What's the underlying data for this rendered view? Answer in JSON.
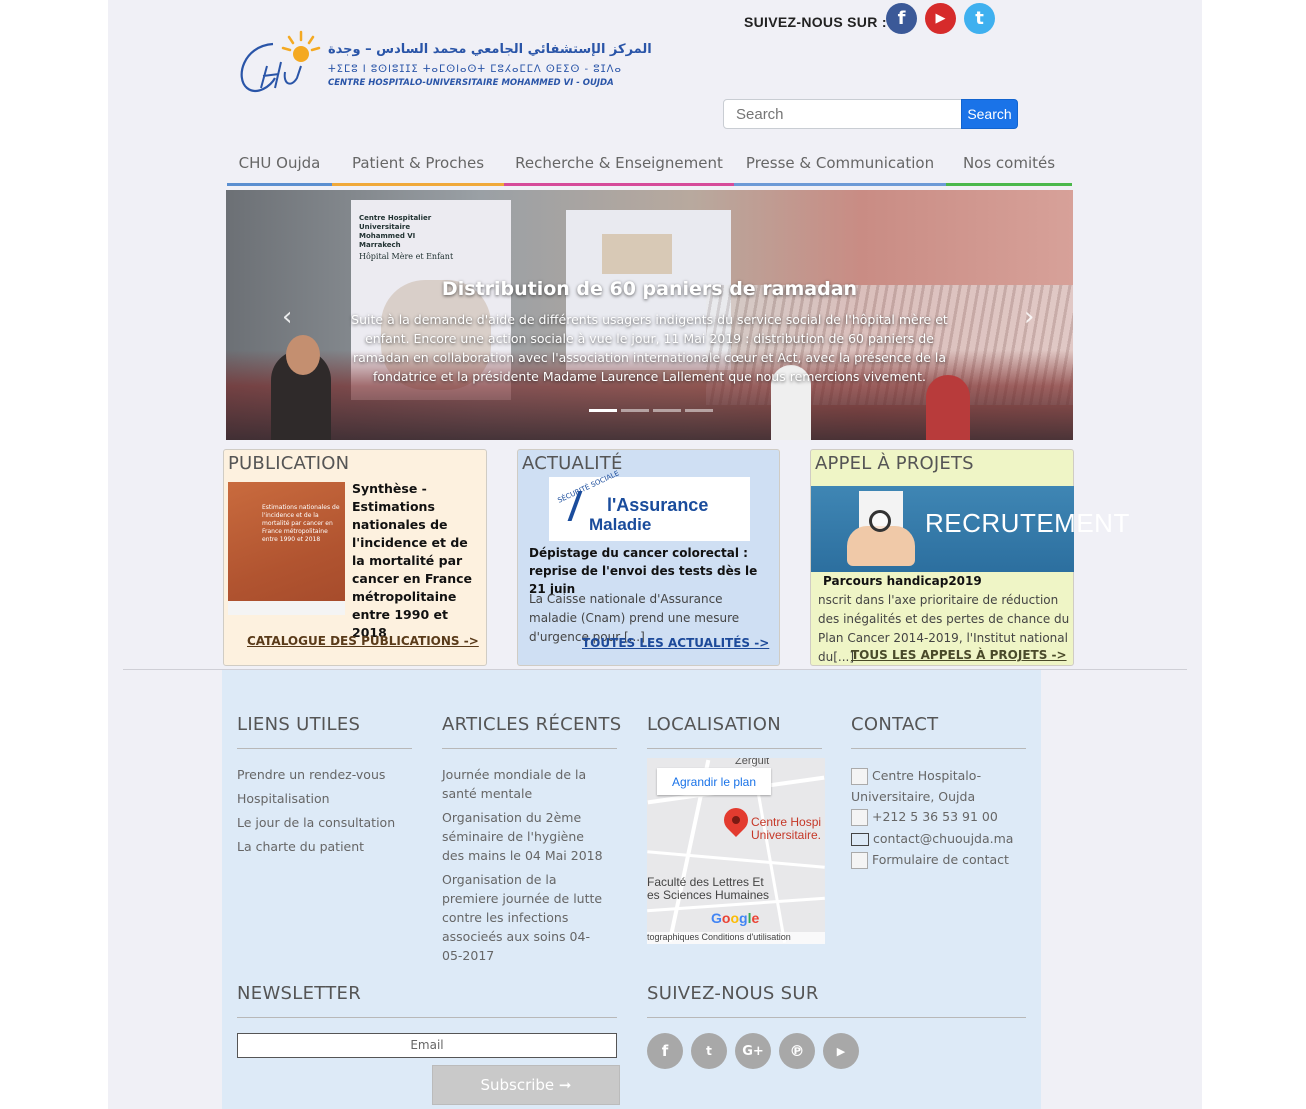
{
  "header": {
    "follow_label": "SUIVEZ-NOUS SUR :",
    "social": [
      {
        "name": "facebook-icon",
        "glyph": "f"
      },
      {
        "name": "youtube-icon",
        "glyph": "▶"
      },
      {
        "name": "twitter-icon",
        "glyph": "t"
      }
    ],
    "logo": {
      "mark": "Chu",
      "arabic": "المركز الإستشفائي الجامعي محمد السادس – وجدة",
      "tifinagh": "ⵜⵉⵎⵓ ⵏ ⵓⵙⵏⵓⵊⵊⵉ ⵜⴰⵎⵙⵏⴰⵙⵜ ⵎⵓⵃⴰⵎⵎⴷ ⵙⴹⵉⵙ - ⵓⵊⴷⴰ",
      "french": "CENTRE HOSPITALO-UNIVERSITAIRE MOHAMMED VI - OUJDA"
    },
    "search": {
      "placeholder": "Search",
      "button": "Search"
    }
  },
  "nav": [
    {
      "label": "CHU Oujda",
      "color": "#5b8fd0"
    },
    {
      "label": "Patient & Proches",
      "color": "#f0a93a"
    },
    {
      "label": "Recherche & Enseignement",
      "color": "#d64b9a"
    },
    {
      "label": "Presse & Communication",
      "color": "#6d9ad6"
    },
    {
      "label": "Nos comités",
      "color": "#4bb84b"
    }
  ],
  "slider": {
    "title": "Distribution de 60 paniers de ramadan",
    "text": "Suite à la demande d'aide de différents usagers indigents du service social de l'hôpital mère et enfant. Encore une action sociale à vue le jour, 11 Mai 2019 : distribution de 60 paniers de ramadan en collaboration avec l'association internationale cœur et Act, avec la présence de la fondatrice et la présidente Madame Laurence Lallement que nous remercions vivement.",
    "prev": "‹",
    "next": "›",
    "board_title": "Centre Hospitalier Universitaire Mohammed VI Marrakech",
    "board_sub": "Hôpital Mère et Enfant"
  },
  "publication": {
    "heading": "PUBLICATION",
    "book_title": "Estimations nationales de l'incidence et de la mortalité par cancer en France métropolitaine entre 1990 et 2018",
    "text": "Synthèse - Estimations nationales de l'incidence et de la mortalité par cancer en France métropolitaine entre 1990 et 2018",
    "link": "CATALOGUE DES PUBLICATIONS ->"
  },
  "actualite": {
    "heading": "ACTUALITÉ",
    "logo_top": "SÉCURITÉ SOCIALE",
    "logo_line1": "l'Assurance",
    "logo_line2": "Maladie",
    "title": "Dépistage du cancer colorectal : reprise de l'envoi des tests dès le 21 juin",
    "body": "La Caisse nationale d'Assurance maladie (Cnam) prend une mesure d'urgence pour [...]",
    "link": "TOUTES LES ACTUALITÉS ->"
  },
  "appel": {
    "heading": "APPEL À PROJETS",
    "banner": "RECRUTEMENT",
    "title": "Parcours handicap2019",
    "body": "nscrit dans l'axe prioritaire de réduction des inégalités et des pertes de chance du Plan Cancer 2014-2019, l'Institut national du[...]",
    "link": "TOUS LES APPELS À PROJETS ->"
  },
  "footer": {
    "liens_heading": "LIENS UTILES",
    "liens": [
      "Prendre un rendez-vous",
      "Hospitalisation",
      "Le jour de la consultation",
      "La charte du patient"
    ],
    "articles_heading": "ARTICLES RÉCENTS",
    "articles": [
      "Journée mondiale de la santé mentale",
      "Organisation du 2ème séminaire de l'hygiène des mains le 04 Mai 2018",
      "Organisation de la premiere journée de lutte contre les infections associeés aux soins 04-05-2017"
    ],
    "localisation_heading": "LOCALISATION",
    "map": {
      "enlarge": "Agrandir le plan",
      "zerguit": "Zerguit",
      "place": "Centre Hospi\nUniversitaire.",
      "faculty": "Faculté des Lettres Et\nes Sciences Humaines",
      "google": "Google",
      "terms": "tographiques   Conditions d'utilisation"
    },
    "contact_heading": "CONTACT",
    "contact": {
      "address": "Centre Hospitalo-Universitaire, Oujda",
      "phone": "+212 5 36 53 91 00",
      "email": "contact@chuoujda.ma",
      "form": "Formulaire de contact"
    },
    "newsletter_heading": "NEWSLETTER",
    "email_placeholder": "Email",
    "subscribe": "Subscribe ➞",
    "follow_heading": "SUIVEZ-NOUS SUR",
    "social": [
      {
        "name": "facebook-icon",
        "glyph": "f"
      },
      {
        "name": "twitter-icon",
        "glyph": "🐦"
      },
      {
        "name": "google-plus-icon",
        "glyph": "G+"
      },
      {
        "name": "pinterest-icon",
        "glyph": "℗"
      },
      {
        "name": "youtube-icon",
        "glyph": "▶"
      }
    ]
  }
}
